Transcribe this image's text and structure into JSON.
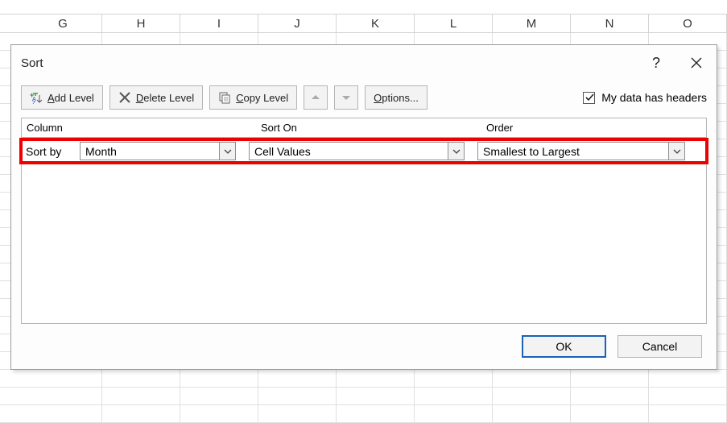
{
  "columns": [
    "G",
    "H",
    "I",
    "J",
    "K",
    "L",
    "M",
    "N",
    "O"
  ],
  "dialog": {
    "title": "Sort",
    "help_label": "?",
    "toolbar": {
      "add": "Add Level",
      "delete": "Delete Level",
      "copy": "Copy Level",
      "options": "Options...",
      "headers_label": "My data has headers",
      "headers_checked": true
    },
    "headers": {
      "column": "Column",
      "sorton": "Sort On",
      "order": "Order"
    },
    "row": {
      "label": "Sort by",
      "column_value": "Month",
      "sorton_value": "Cell Values",
      "order_value": "Smallest to Largest"
    },
    "footer": {
      "ok": "OK",
      "cancel": "Cancel"
    }
  }
}
